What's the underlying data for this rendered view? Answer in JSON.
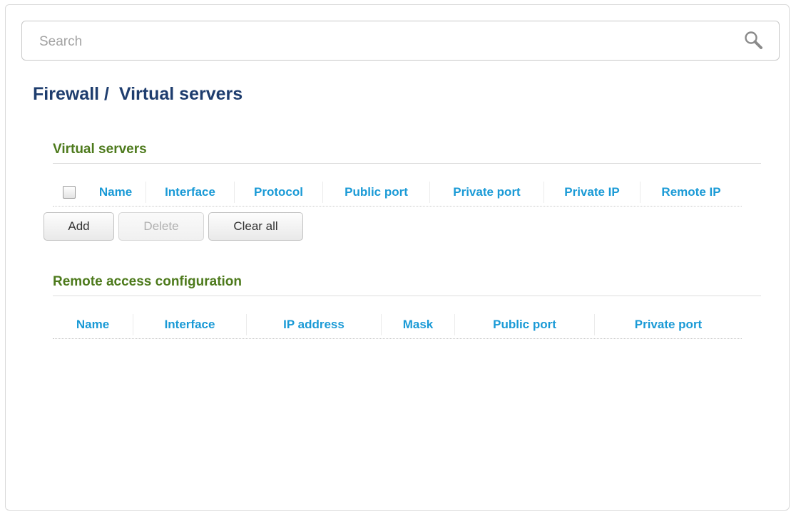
{
  "search": {
    "placeholder": "Search",
    "icon": "search-icon"
  },
  "breadcrumb": {
    "parent": "Firewall /",
    "current": "Virtual servers"
  },
  "virtual_servers": {
    "title": "Virtual servers",
    "select_all_checked": false,
    "columns": [
      "Name",
      "Interface",
      "Protocol",
      "Public port",
      "Private port",
      "Private IP",
      "Remote IP"
    ],
    "rows": [],
    "buttons": {
      "add": "Add",
      "delete": "Delete",
      "clear_all": "Clear all"
    }
  },
  "remote_access": {
    "title": "Remote access configuration",
    "columns": [
      "Name",
      "Interface",
      "IP address",
      "Mask",
      "Public port",
      "Private port"
    ],
    "rows": []
  },
  "colors": {
    "title": "#1e3d6e",
    "section_title": "#4d7a1c",
    "column_header": "#1a9ad6"
  }
}
